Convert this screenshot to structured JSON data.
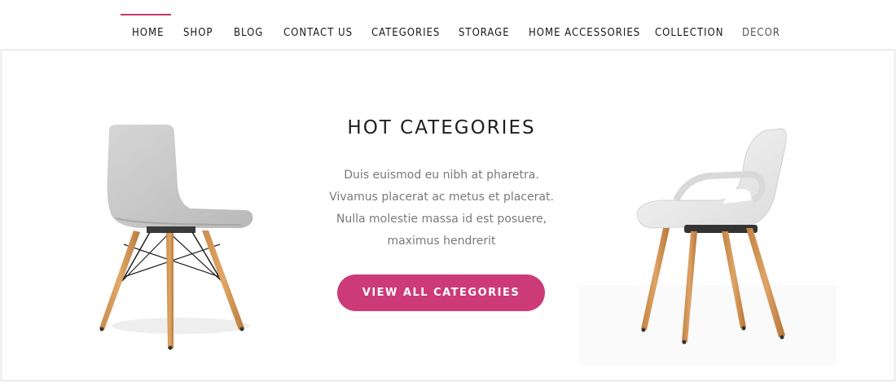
{
  "nav": {
    "items": [
      {
        "label": "HOME",
        "active": true
      },
      {
        "label": "SHOP"
      },
      {
        "label": "BLOG"
      },
      {
        "label": "CONTACT US"
      },
      {
        "label": "CATEGORIES"
      },
      {
        "label": "STORAGE"
      },
      {
        "label": "HOME ACCESSORIES"
      },
      {
        "label": "COLLECTION"
      },
      {
        "label": "DECOR"
      }
    ],
    "active_color": "#c8366f"
  },
  "hero": {
    "title": "HOT CATEGORIES",
    "description": "Duis euismod eu nibh at pharetra. Vivamus placerat ac metus et placerat. Nulla molestie massa id est posuere, maximus hendrerit",
    "cta_label": "VIEW ALL CATEGORIES",
    "cta_color": "#cc3b78"
  },
  "products": [
    {
      "name": "grey-side-chair",
      "icon": "chair-image"
    },
    {
      "name": "white-armchair",
      "icon": "armchair-image"
    }
  ]
}
